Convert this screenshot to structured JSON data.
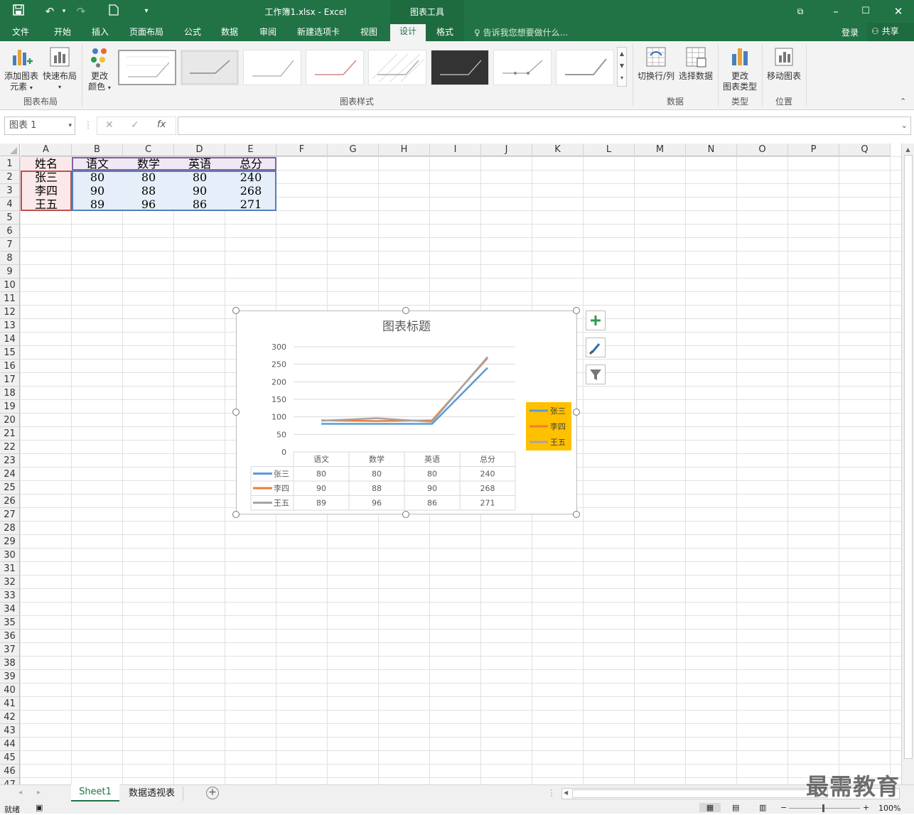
{
  "titlebar": {
    "document_title": "工作簿1.xlsx - Excel",
    "context_tab_group": "图表工具",
    "login": "登录",
    "share": "共享"
  },
  "tabs": [
    "文件",
    "开始",
    "插入",
    "页面布局",
    "公式",
    "数据",
    "审阅",
    "新建选项卡",
    "视图",
    "设计",
    "格式"
  ],
  "active_tab": "设计",
  "tell_me": "告诉我您想要做什么...",
  "ribbon": {
    "add_chart_element_1": "添加图表",
    "add_chart_element_2": "元素",
    "quick_layout": "快速布局",
    "change_colors_1": "更改",
    "change_colors_2": "颜色",
    "group_layout": "图表布局",
    "group_styles": "图表样式",
    "switch_row_col": "切换行/列",
    "select_data": "选择数据",
    "group_data": "数据",
    "change_type_1": "更改",
    "change_type_2": "图表类型",
    "group_type": "类型",
    "move_chart": "移动图表",
    "group_location": "位置"
  },
  "formula_bar": {
    "name_box": "图表 1",
    "cancel_icon": "✕",
    "enter_icon": "✓",
    "fx": "fx",
    "formula": ""
  },
  "columns": [
    "A",
    "B",
    "C",
    "D",
    "E",
    "F",
    "G",
    "H",
    "I",
    "J",
    "K",
    "L",
    "M",
    "N",
    "O",
    "P",
    "Q"
  ],
  "rows": [
    "1",
    "2",
    "3",
    "4",
    "5",
    "6",
    "7",
    "8",
    "9",
    "10",
    "11",
    "12",
    "13",
    "14",
    "15",
    "16",
    "17",
    "18",
    "19",
    "20",
    "21",
    "22",
    "23",
    "24",
    "25",
    "26",
    "27",
    "28",
    "29",
    "30",
    "31",
    "32",
    "33",
    "34",
    "35",
    "36",
    "37",
    "38",
    "39",
    "40",
    "41",
    "42",
    "43",
    "44",
    "45",
    "46",
    "47"
  ],
  "table": {
    "header": [
      "姓名",
      "语文",
      "数学",
      "英语",
      "总分"
    ],
    "rows": [
      [
        "张三",
        "80",
        "80",
        "80",
        "240"
      ],
      [
        "李四",
        "90",
        "88",
        "90",
        "268"
      ],
      [
        "王五",
        "89",
        "96",
        "86",
        "271"
      ]
    ]
  },
  "chart_data": {
    "type": "line",
    "title": "图表标题",
    "categories": [
      "语文",
      "数学",
      "英语",
      "总分"
    ],
    "series": [
      {
        "name": "张三",
        "values": [
          80,
          80,
          80,
          240
        ],
        "color": "#5b9bd5"
      },
      {
        "name": "李四",
        "values": [
          90,
          88,
          90,
          268
        ],
        "color": "#ed7d31"
      },
      {
        "name": "王五",
        "values": [
          89,
          96,
          86,
          271
        ],
        "color": "#a5a5a5"
      }
    ],
    "ylim": [
      0,
      300
    ],
    "yticks": [
      "0",
      "50",
      "100",
      "150",
      "200",
      "250",
      "300"
    ],
    "legend_position": "right",
    "legend_background": "#ffc000",
    "grid": true,
    "data_table": true
  },
  "sheets": [
    "Sheet1",
    "数据透视表"
  ],
  "active_sheet": "Sheet1",
  "status": {
    "ready": "就绪",
    "zoom": "100%"
  }
}
